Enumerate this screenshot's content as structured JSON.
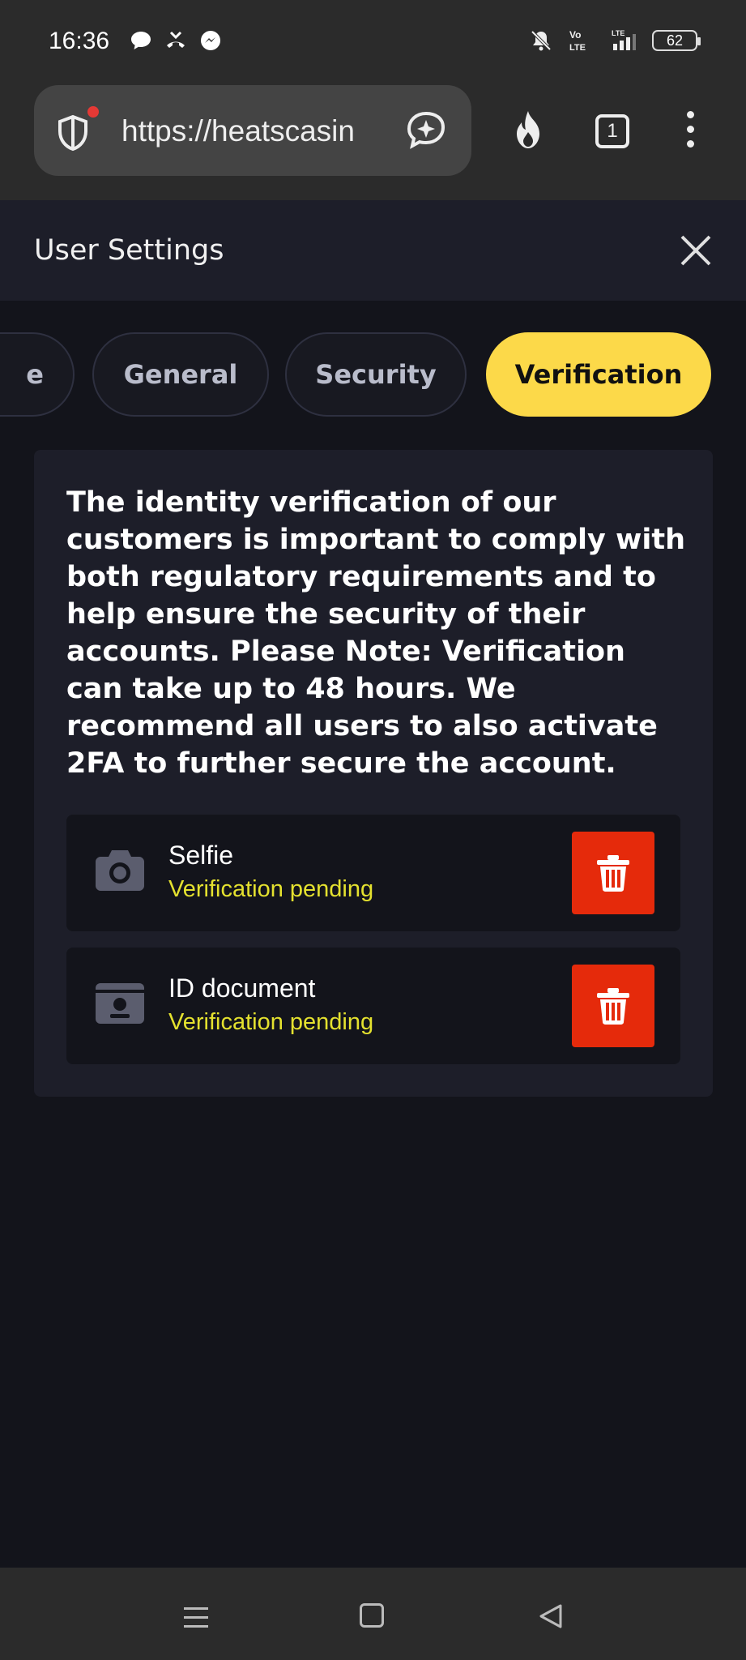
{
  "status_bar": {
    "time": "16:36",
    "battery": "62"
  },
  "browser": {
    "url": "https://heatscasin",
    "tab_count": "1"
  },
  "modal": {
    "title": "User Settings"
  },
  "tabs": [
    {
      "label": "e"
    },
    {
      "label": "General"
    },
    {
      "label": "Security"
    },
    {
      "label": "Verification",
      "active": true
    }
  ],
  "verification": {
    "intro": "The identity verification of our customers is important to comply with both regulatory requirements and to help ensure the security of their accounts. Please Note: Verification can take up to 48 hours. We recommend all users to also activate 2FA to further secure the account.",
    "documents": [
      {
        "name": "Selfie",
        "status": "Verification pending",
        "icon": "camera-icon"
      },
      {
        "name": "ID document",
        "status": "Verification pending",
        "icon": "id-card-icon"
      }
    ]
  },
  "colors": {
    "accent": "#fcd949",
    "pending": "#e4e12f",
    "delete": "#e52a0b",
    "panel": "#1d1e29",
    "background": "#13141b"
  }
}
